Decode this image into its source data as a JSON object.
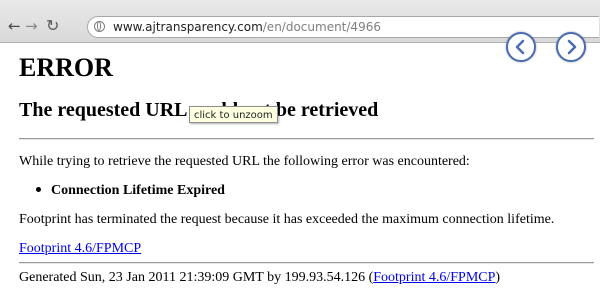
{
  "browser": {
    "back_glyph": "←",
    "forward_glyph": "→",
    "reload_glyph": "↻",
    "url_host": "www.ajtransparency.com",
    "url_path": "/en/document/4966"
  },
  "overlay": {
    "prev_label": "previous",
    "next_label": "next",
    "accent_color": "#4b6cb0"
  },
  "tooltip": {
    "text": "click to unzoom"
  },
  "page": {
    "heading": "ERROR",
    "subheading": "The requested URL could not be retrieved",
    "intro": "While trying to retrieve the requested URL the following error was encountered:",
    "error_item": "Connection Lifetime Expired",
    "detail": "Footprint has terminated the request because it has exceeded the maximum connection lifetime.",
    "link_text": "Footprint 4.6/FPMCP",
    "footer_prefix": "Generated Sun, 23 Jan 2011 21:39:09 GMT by 199.93.54.126 (",
    "footer_link": "Footprint 4.6/FPMCP",
    "footer_suffix": ")"
  }
}
